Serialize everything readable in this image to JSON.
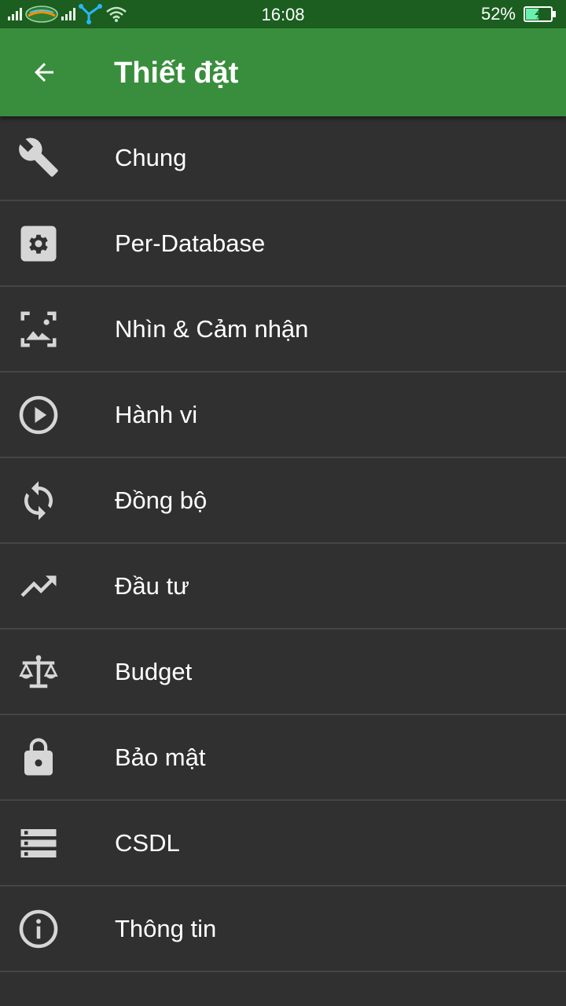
{
  "status_bar": {
    "time": "16:08",
    "battery_percent": "52%",
    "battery_level": 0.52,
    "battery_color": "#69f0ae"
  },
  "app_bar": {
    "title": "Thiết đặt",
    "back_icon": "arrow-back-icon",
    "background": "#388e3c"
  },
  "menu": {
    "items": [
      {
        "label": "Chung",
        "icon": "wrench-icon"
      },
      {
        "label": "Per-Database",
        "icon": "gear-icon"
      },
      {
        "label": "Nhìn & Cảm nhận",
        "icon": "image-frame-icon"
      },
      {
        "label": "Hành vi",
        "icon": "play-circle-icon"
      },
      {
        "label": "Đồng bộ",
        "icon": "sync-icon"
      },
      {
        "label": "Đầu tư",
        "icon": "trending-up-icon"
      },
      {
        "label": "Budget",
        "icon": "scale-icon"
      },
      {
        "label": "Bảo mật",
        "icon": "lock-icon"
      },
      {
        "label": "CSDL",
        "icon": "storage-icon"
      },
      {
        "label": "Thông tin",
        "icon": "info-icon"
      }
    ]
  }
}
